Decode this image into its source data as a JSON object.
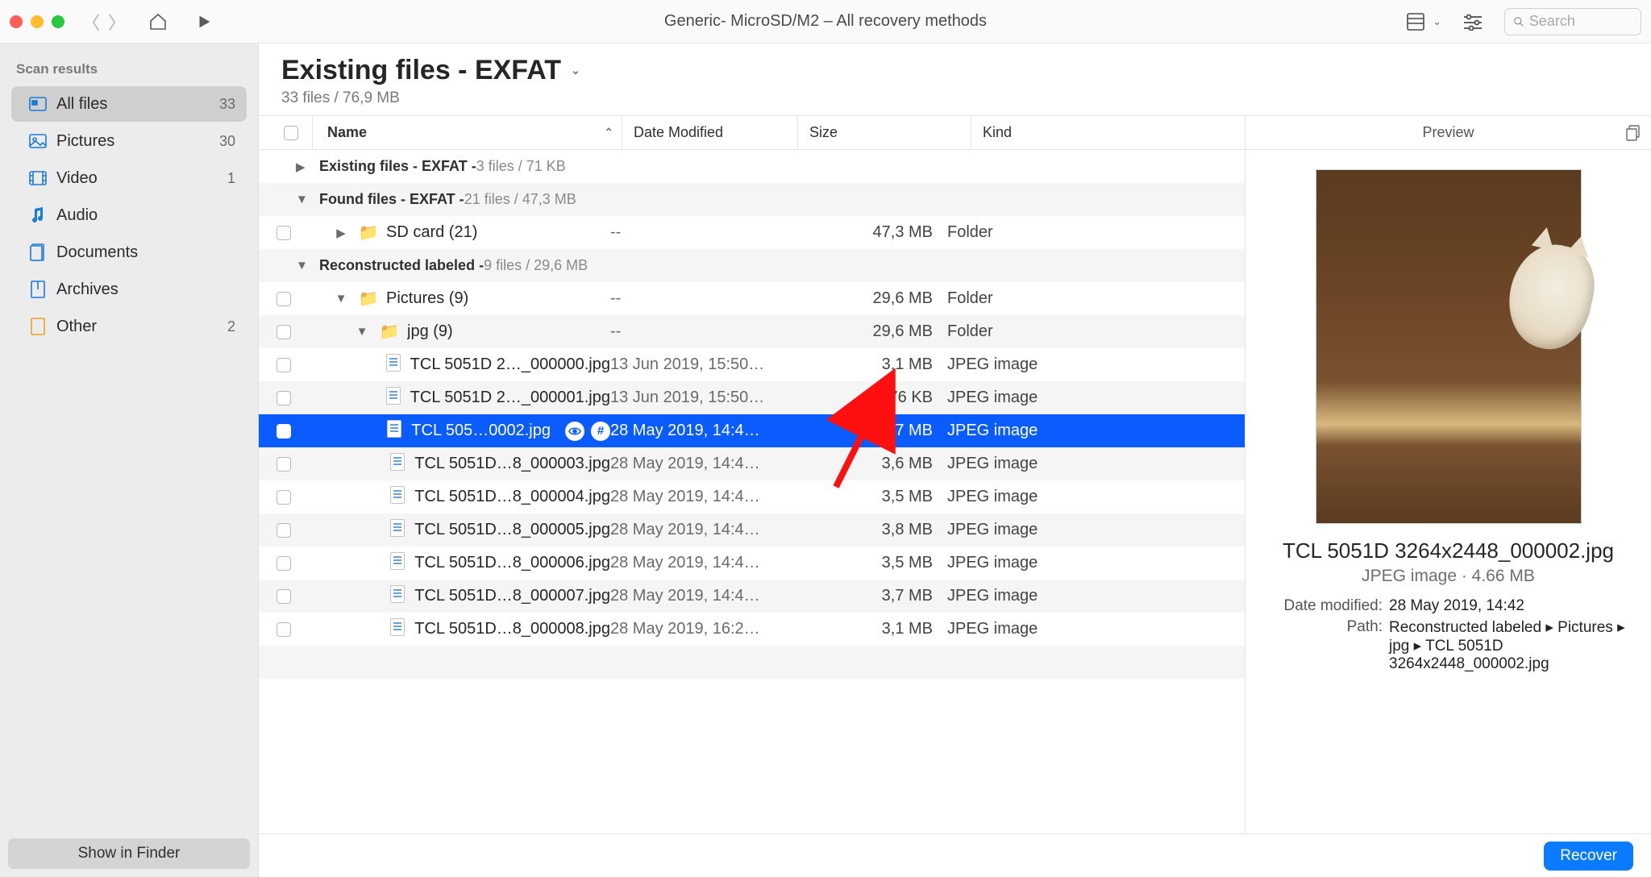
{
  "titlebar": {
    "title": "Generic- MicroSD/M2 – All recovery methods",
    "search_placeholder": "Search"
  },
  "sidebar": {
    "header": "Scan results",
    "items": [
      {
        "icon": "all",
        "label": "All files",
        "count": "33",
        "active": true
      },
      {
        "icon": "pictures",
        "label": "Pictures",
        "count": "30"
      },
      {
        "icon": "video",
        "label": "Video",
        "count": "1"
      },
      {
        "icon": "audio",
        "label": "Audio",
        "count": ""
      },
      {
        "icon": "documents",
        "label": "Documents",
        "count": ""
      },
      {
        "icon": "archives",
        "label": "Archives",
        "count": ""
      },
      {
        "icon": "other",
        "label": "Other",
        "count": "2"
      }
    ],
    "show_in_finder": "Show in Finder"
  },
  "main": {
    "title": "Existing files - EXFAT",
    "subtitle": "33 files / 76,9 MB",
    "columns": {
      "name": "Name",
      "date": "Date Modified",
      "size": "Size",
      "kind": "Kind"
    },
    "groups": [
      {
        "expanded": false,
        "label": "Existing files - EXFAT -",
        "meta": " 3 files / 71 KB"
      },
      {
        "expanded": true,
        "label": "Found files - EXFAT -",
        "meta": " 21 files / 47,3 MB"
      }
    ],
    "folder1": {
      "name": "SD card (21)",
      "date": "--",
      "size": "47,3 MB",
      "kind": "Folder"
    },
    "group3": {
      "label": "Reconstructed labeled -",
      "meta": " 9 files / 29,6 MB"
    },
    "folder2": {
      "name": "Pictures (9)",
      "date": "--",
      "size": "29,6 MB",
      "kind": "Folder"
    },
    "folder3": {
      "name": "jpg (9)",
      "date": "--",
      "size": "29,6 MB",
      "kind": "Folder"
    },
    "files": [
      {
        "name": "TCL 5051D 2…_000000.jpg",
        "date": "13 Jun 2019, 15:50…",
        "size": "3,1 MB",
        "kind": "JPEG image"
      },
      {
        "name": "TCL 5051D 2…_000001.jpg",
        "date": "13 Jun 2019, 15:50…",
        "size": "776 KB",
        "kind": "JPEG image"
      },
      {
        "name": "TCL 505…0002.jpg",
        "date": "28 May 2019, 14:4…",
        "size": "4,7 MB",
        "kind": "JPEG image",
        "selected": true
      },
      {
        "name": "TCL 5051D…8_000003.jpg",
        "date": "28 May 2019, 14:4…",
        "size": "3,6 MB",
        "kind": "JPEG image"
      },
      {
        "name": "TCL 5051D…8_000004.jpg",
        "date": "28 May 2019, 14:4…",
        "size": "3,5 MB",
        "kind": "JPEG image"
      },
      {
        "name": "TCL 5051D…8_000005.jpg",
        "date": "28 May 2019, 14:4…",
        "size": "3,8 MB",
        "kind": "JPEG image"
      },
      {
        "name": "TCL 5051D…8_000006.jpg",
        "date": "28 May 2019, 14:4…",
        "size": "3,5 MB",
        "kind": "JPEG image"
      },
      {
        "name": "TCL 5051D…8_000007.jpg",
        "date": "28 May 2019, 14:4…",
        "size": "3,7 MB",
        "kind": "JPEG image"
      },
      {
        "name": "TCL 5051D…8_000008.jpg",
        "date": "28 May 2019, 16:2…",
        "size": "3,1 MB",
        "kind": "JPEG image"
      }
    ]
  },
  "preview": {
    "header": "Preview",
    "filename": "TCL 5051D 3264x2448_000002.jpg",
    "kind_size": "JPEG image · 4.66 MB",
    "date_label": "Date modified:",
    "date_value": "28 May 2019, 14:42",
    "path_label": "Path:",
    "path_value": "Reconstructed labeled ▸ Pictures ▸ jpg ▸ TCL 5051D 3264x2448_000002.jpg"
  },
  "footer": {
    "recover": "Recover"
  }
}
